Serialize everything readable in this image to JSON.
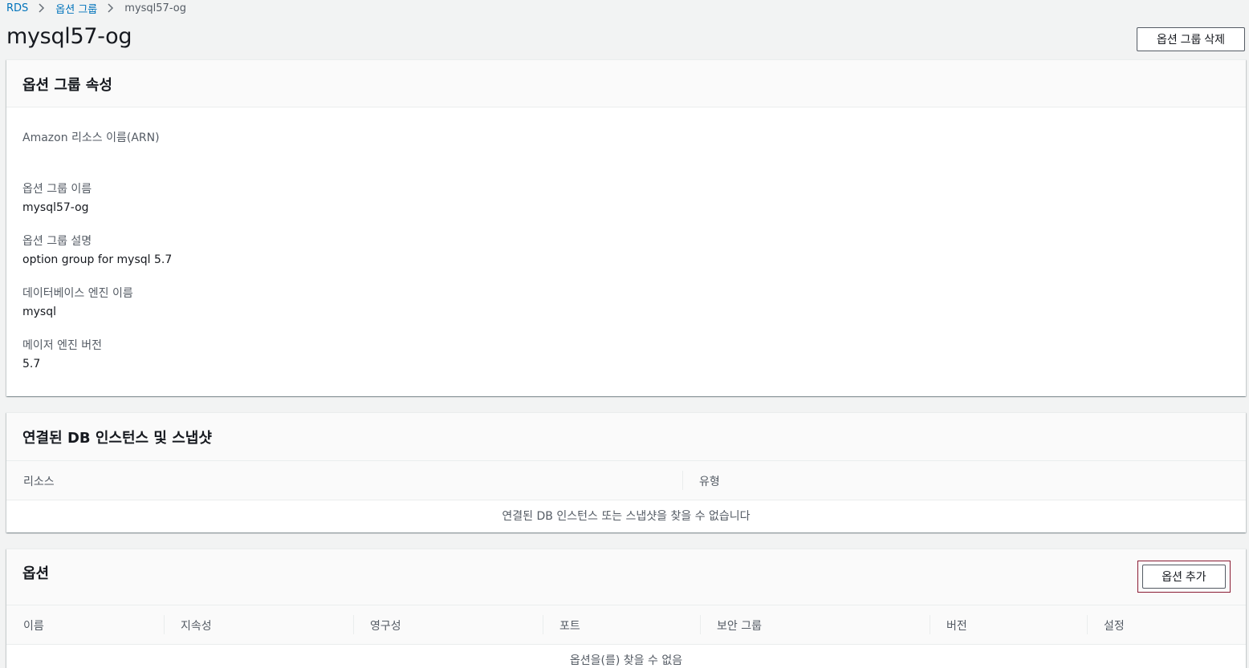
{
  "breadcrumb": {
    "items": [
      "RDS",
      "옵션 그룹",
      "mysql57-og"
    ]
  },
  "page": {
    "title": "mysql57-og",
    "delete_button": "옵션 그룹 삭제"
  },
  "properties": {
    "title": "옵션 그룹 속성",
    "fields": [
      {
        "label": "Amazon 리소스 이름(ARN)",
        "value": ""
      },
      {
        "label": "옵션 그룹 이름",
        "value": "mysql57-og"
      },
      {
        "label": "옵션 그룹 설명",
        "value": "option group for mysql 5.7"
      },
      {
        "label": "데이터베이스 엔진 이름",
        "value": "mysql"
      },
      {
        "label": "메이저 엔진 버전",
        "value": "5.7"
      }
    ]
  },
  "associated": {
    "title": "연결된 DB 인스턴스 및 스냅샷",
    "columns": [
      "리소스",
      "유형"
    ],
    "empty_message": "연결된 DB 인스턴스 또는 스냅샷을 찾을 수 없습니다"
  },
  "options": {
    "title": "옵션",
    "add_button": "옵션 추가",
    "columns": [
      "이름",
      "지속성",
      "영구성",
      "포트",
      "보안 그룹",
      "버전",
      "설정"
    ],
    "empty_message": "옵션을(를) 찾을 수 없음"
  },
  "colors": {
    "link": "#0073bb",
    "background": "#f2f3f3",
    "focus_outline": "#8b1d35"
  }
}
